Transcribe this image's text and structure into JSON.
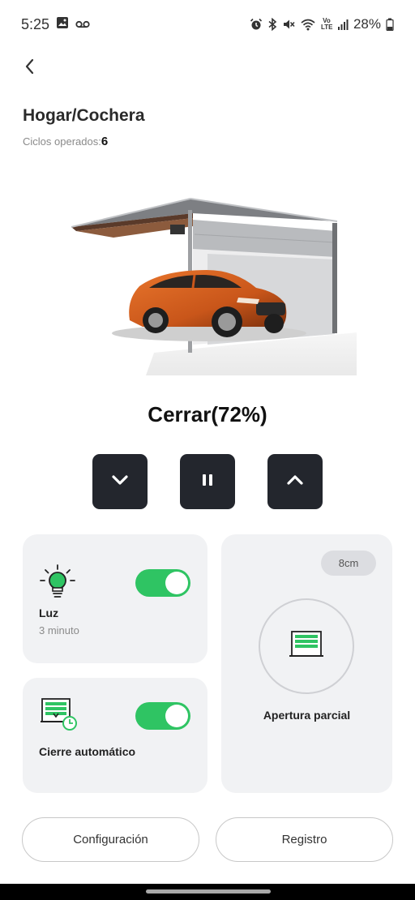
{
  "status_bar": {
    "time": "5:25",
    "battery": "28%",
    "icons": [
      "image-icon",
      "voicemail-icon",
      "alarm-icon",
      "bluetooth-icon",
      "mute-icon",
      "wifi-icon",
      "volte-icon",
      "signal-icon",
      "battery-icon"
    ],
    "volte_label": "Vo LTE"
  },
  "header": {
    "back_icon": "chevron-left-icon",
    "title": "Hogar/Cochera",
    "cycles_label": "Ciclos operados:",
    "cycles_value": "6"
  },
  "status": {
    "text": "Cerrar(72%)"
  },
  "controls": {
    "down_icon": "chevron-down-icon",
    "pause_icon": "pause-icon",
    "up_icon": "chevron-up-icon"
  },
  "light_card": {
    "icon": "light-bulb-icon",
    "label": "Luz",
    "sub": "3 minuto",
    "toggle_on": true
  },
  "auto_close_card": {
    "icon": "auto-close-icon",
    "label": "Cierre automático",
    "toggle_on": true
  },
  "partial_card": {
    "pill": "8cm",
    "icon": "garage-door-icon",
    "label": "Apertura parcial"
  },
  "bottom": {
    "config_label": "Configuración",
    "log_label": "Registro"
  },
  "colors": {
    "accent_green": "#2fc463",
    "button_dark": "#23262d",
    "card_bg": "#f1f2f4"
  }
}
